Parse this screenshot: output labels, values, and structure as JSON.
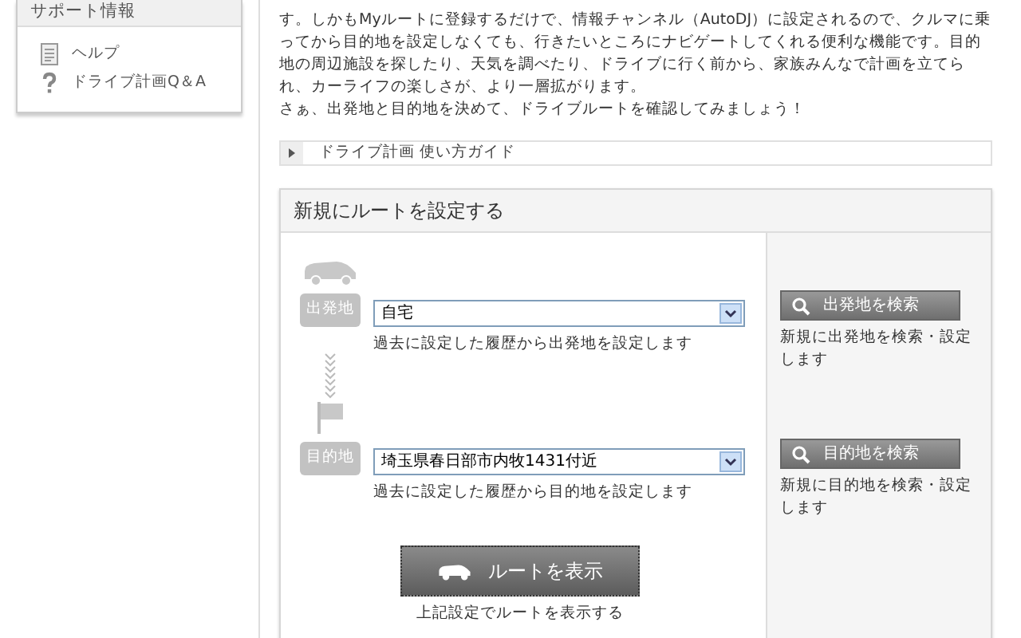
{
  "sidebar": {
    "title": "サポート情報",
    "items": [
      {
        "kind": "document",
        "label": "ヘルプ"
      },
      {
        "kind": "question",
        "label": "ドライブ計画Q＆A"
      }
    ]
  },
  "intro": {
    "paragraphs": [
      "す。しかもMyルートに登録するだけで、情報チャンネル（AutoDJ）に設定されるので、クルマに乗ってから目的地を設定しなくても、行きたいところにナビゲートしてくれる便利な機能です。目的地の周辺施設を探したり、天気を調べたり、ドライブに行く前から、家族みんなで計画を立てられ、カーライフの楽しさが、より一層拡がります。",
      "さぁ、出発地と目的地を決めて、ドライブルートを確認してみましょう！"
    ]
  },
  "guide": {
    "label": "ドライブ計画 使い方ガイド",
    "expanded": false
  },
  "route_form": {
    "title": "新規にルートを設定する",
    "points": [
      {
        "kind": "origin",
        "tag": "出発地",
        "value": "自宅",
        "hint": "過去に設定した履歴から出発地を設定します",
        "search_button": "出発地を検索",
        "search_note": "新規に出発地を検索・設定します"
      },
      {
        "kind": "destination",
        "tag": "目的地",
        "value": "埼玉県春日部市内牧1431付近",
        "hint": "過去に設定した履歴から目的地を設定します",
        "search_button": "目的地を検索",
        "search_note": "新規に目的地を検索・設定します"
      }
    ],
    "submit": {
      "label": "ルートを表示",
      "caption": "上記設定でルートを表示する"
    }
  }
}
